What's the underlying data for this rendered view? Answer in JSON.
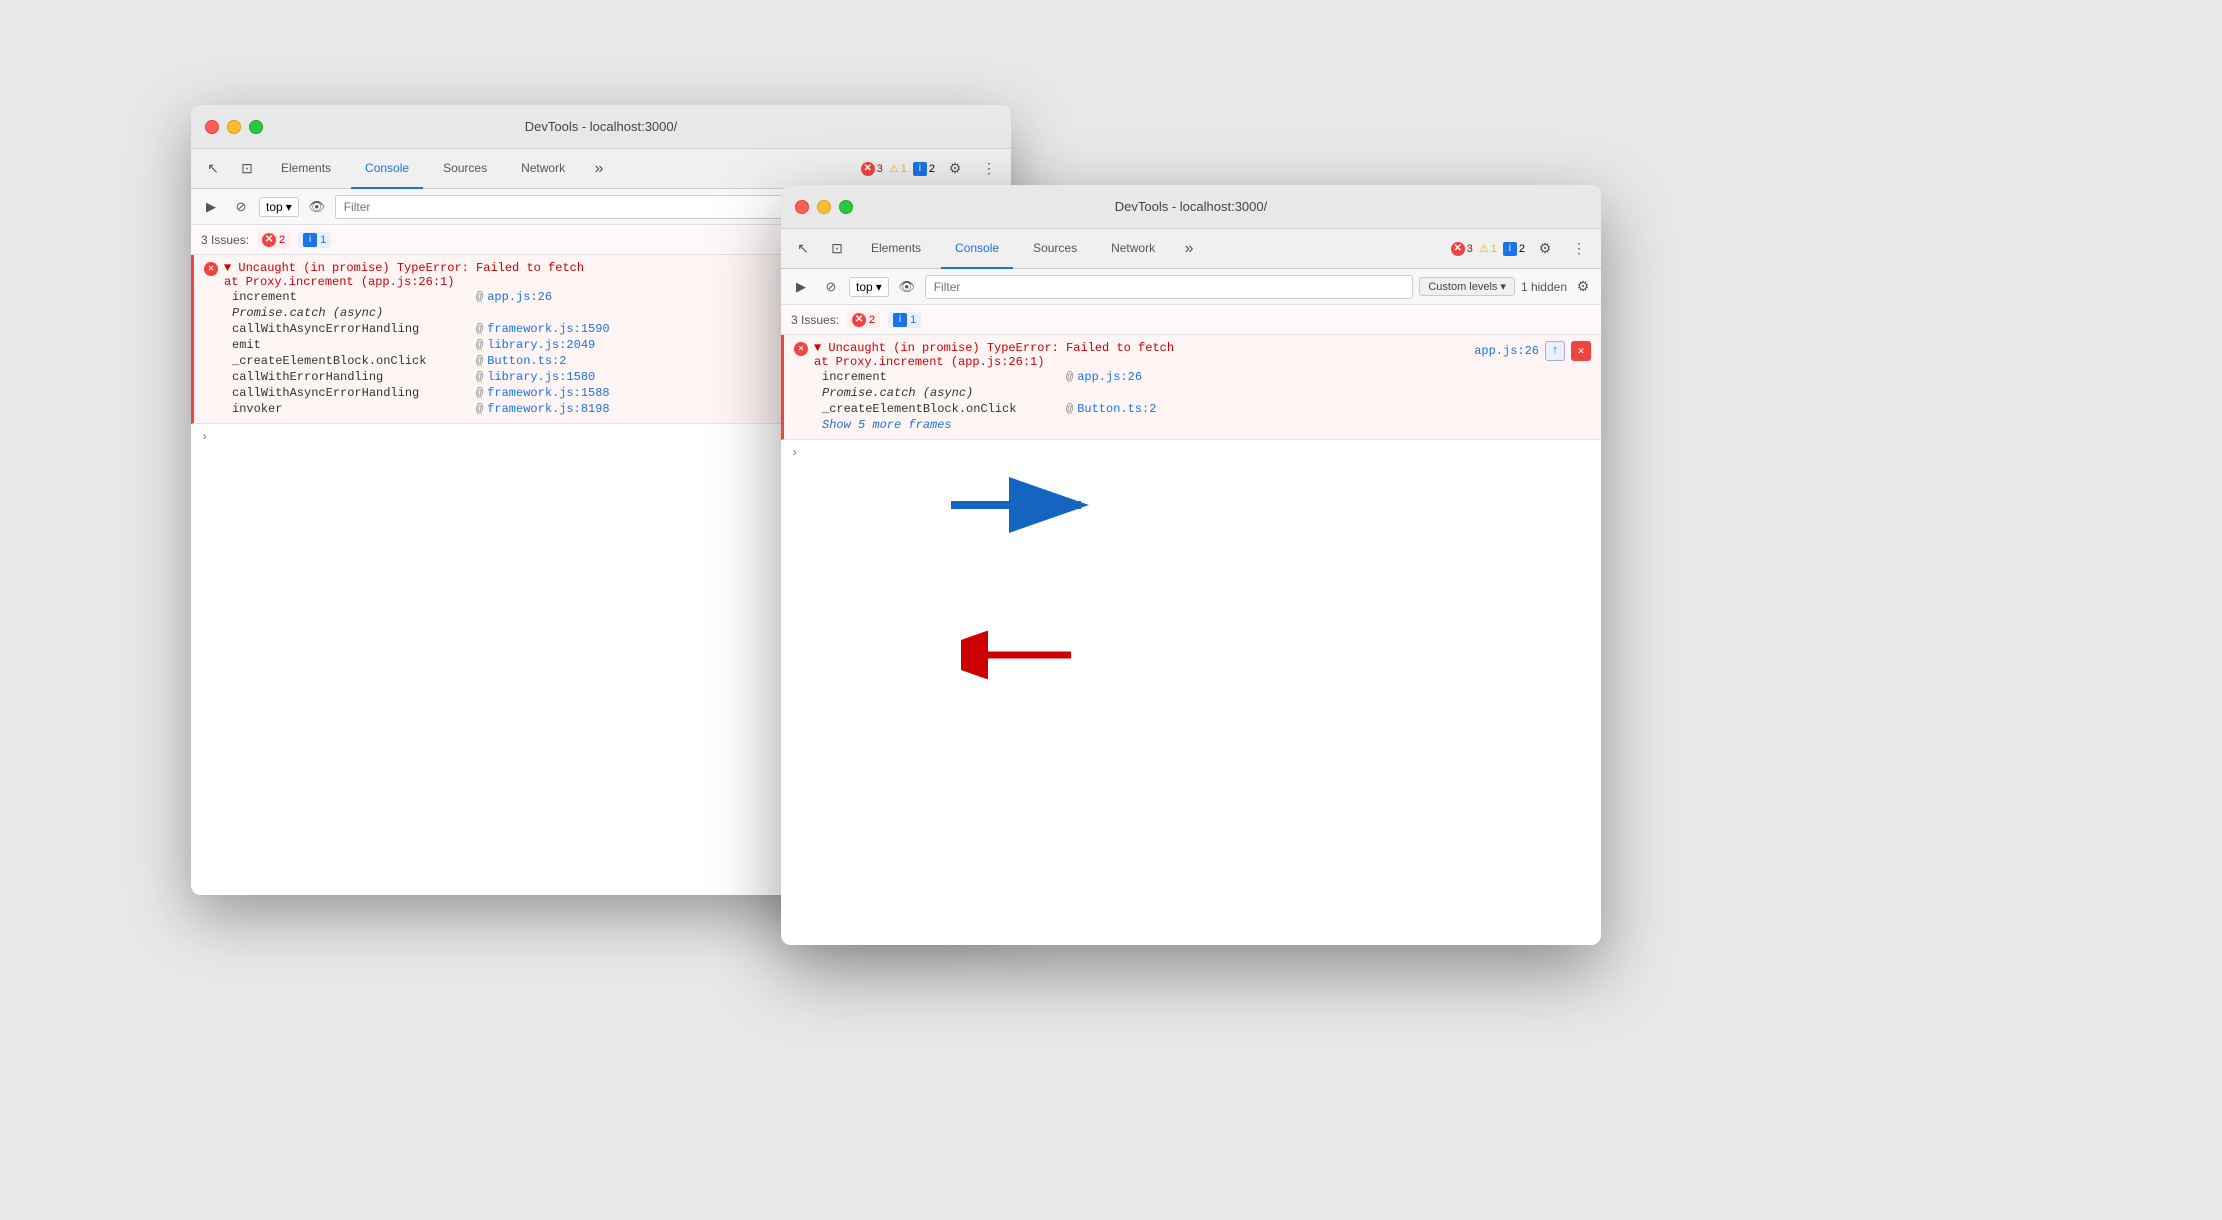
{
  "back_window": {
    "title": "DevTools - localhost:3000/",
    "tabs": [
      "Elements",
      "Console",
      "Sources",
      "Network"
    ],
    "active_tab": "Console",
    "console_toolbar": {
      "top_label": "top",
      "filter_placeholder": "Filter"
    },
    "issues": {
      "label": "3 Issues:",
      "error_count": "2",
      "info_count": "1"
    },
    "error": {
      "main": "▼ Uncaught (in promise) TypeError: Failed to fetch",
      "sub": "at Proxy.increment (app.js:26:1)",
      "stack": [
        {
          "func": "increment",
          "at": "@",
          "link": "app.js:26",
          "href": "#"
        },
        {
          "func": "Promise.catch (async)",
          "at": "",
          "link": "",
          "href": ""
        },
        {
          "func": "callWithAsyncErrorHandling",
          "at": "@",
          "link": "framework.js:1590",
          "href": "#"
        },
        {
          "func": "emit",
          "at": "@",
          "link": "library.js:2049",
          "href": "#"
        },
        {
          "func": "_createElementBlock.onClick",
          "at": "@",
          "link": "Button.ts:2",
          "href": "#"
        },
        {
          "func": "callWithErrorHandling",
          "at": "@",
          "link": "library.js:1580",
          "href": "#"
        },
        {
          "func": "callWithAsyncErrorHandling",
          "at": "@",
          "link": "framework.js:1588",
          "href": "#"
        },
        {
          "func": "invoker",
          "at": "@",
          "link": "framework.js:8198",
          "href": "#"
        }
      ]
    },
    "badges_right": {
      "errors": "3",
      "warnings": "1",
      "info": "2"
    }
  },
  "front_window": {
    "title": "DevTools - localhost:3000/",
    "tabs": [
      "Elements",
      "Console",
      "Sources",
      "Network"
    ],
    "active_tab": "Console",
    "console_toolbar": {
      "top_label": "top",
      "filter_placeholder": "Filter",
      "custom_levels": "Custom levels",
      "hidden": "1 hidden"
    },
    "issues": {
      "label": "3 Issues:",
      "error_count": "2",
      "info_count": "1"
    },
    "error": {
      "main": "▼ Uncaught (in promise) TypeError: Failed to fetch",
      "sub": "at Proxy.increment (app.js:26:1)",
      "link_right": "app.js:26",
      "stack": [
        {
          "func": "increment",
          "at": "@",
          "link": "app.js:26",
          "href": "#"
        },
        {
          "func": "Promise.catch (async)",
          "at": "",
          "link": "",
          "href": ""
        },
        {
          "func": "_createElementBlock.onClick",
          "at": "@",
          "link": "Button.ts:2",
          "href": "#"
        }
      ],
      "show_more": "Show 5 more frames"
    },
    "badges_right": {
      "errors": "3",
      "warnings": "1",
      "info": "2"
    }
  },
  "icons": {
    "close": "×",
    "chevron_down": "▾",
    "eye": "👁",
    "cursor": "↖",
    "layers": "⊡",
    "play": "▶",
    "ban": "⊘",
    "gear": "⚙",
    "dots": "⋮",
    "more": "»",
    "caret": "›",
    "arrow_up": "↑",
    "x": "✕"
  }
}
